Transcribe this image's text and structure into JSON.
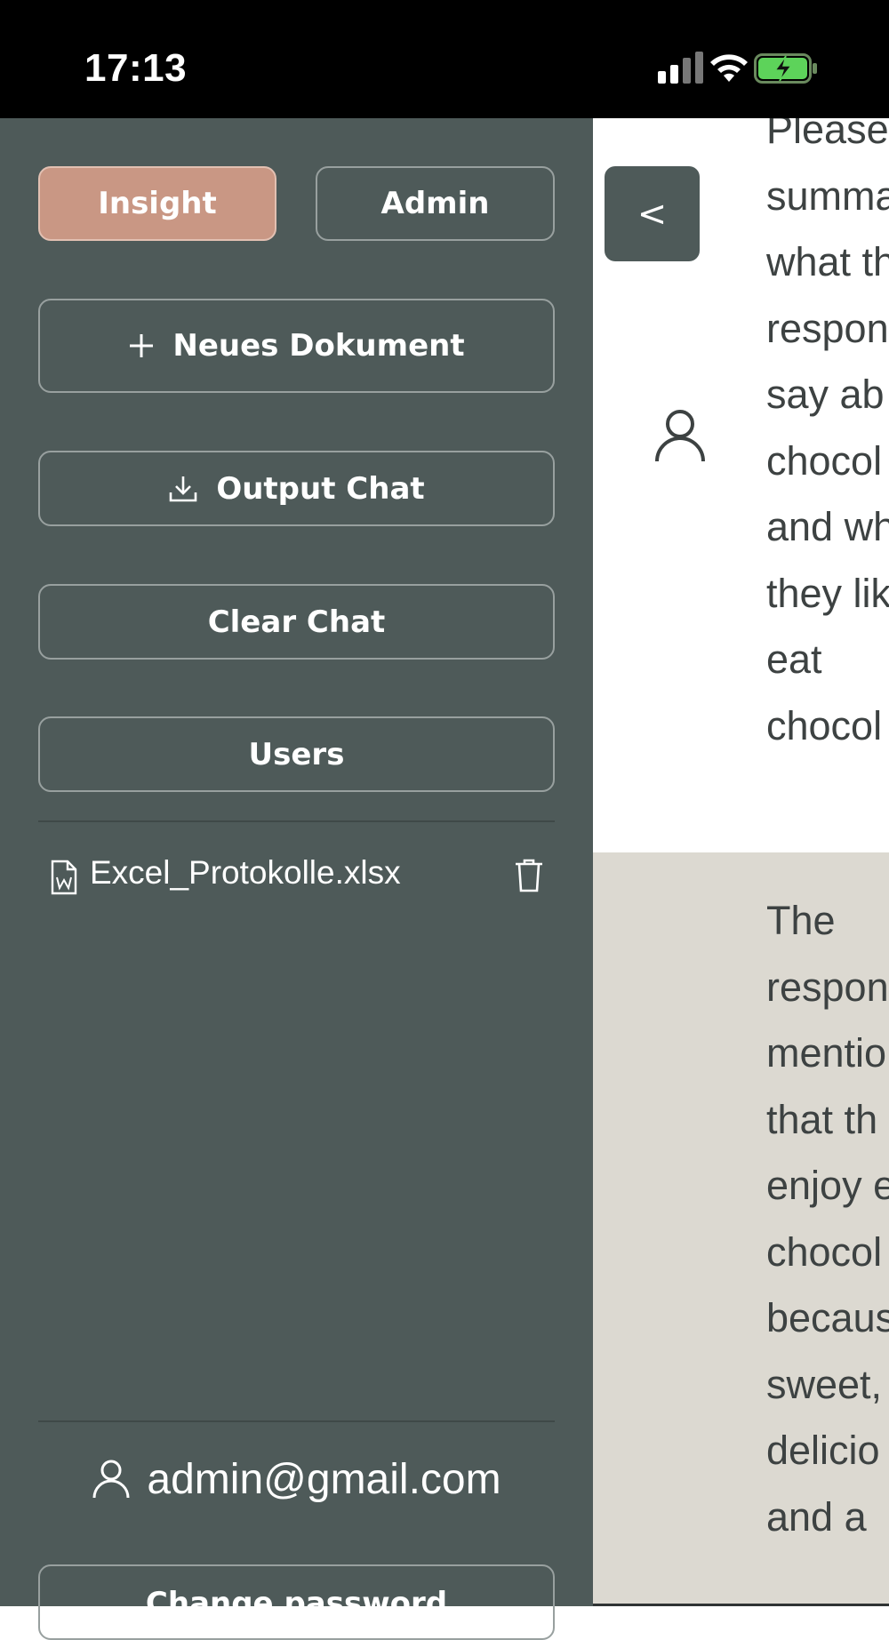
{
  "status_bar": {
    "time": "17:13",
    "icons": [
      "signal-icon",
      "wifi-icon",
      "battery-charging-icon"
    ]
  },
  "sidebar": {
    "mode_tabs": [
      {
        "label": "Insight",
        "active": true
      },
      {
        "label": "Admin",
        "active": false
      }
    ],
    "new_document_label": "Neues Dokument",
    "output_chat_label": "Output Chat",
    "clear_chat_label": "Clear Chat",
    "users_label": "Users",
    "files": [
      {
        "name": "Excel_Protokolle.xlsx"
      }
    ],
    "account_email": "admin@gmail.com",
    "change_password_label": "Change password"
  },
  "chat": {
    "collapse_label": "<",
    "messages": [
      {
        "role": "user",
        "text": "Please\nsumma\nwhat th\nrespon\nsay ab\nchocol\nand wh\nthey lik\neat\nchocol"
      },
      {
        "role": "assistant",
        "text": "The\nrespon\nmentio\nthat th\nenjoy e\nchocol\nbecaus\nsweet,\ndelicio\nand a"
      }
    ]
  },
  "colors": {
    "sidebar_bg": "#4e5a59",
    "accent": "#c99784",
    "assistant_msg_bg": "#dcd9d1",
    "status_bar_bg": "#000000"
  }
}
